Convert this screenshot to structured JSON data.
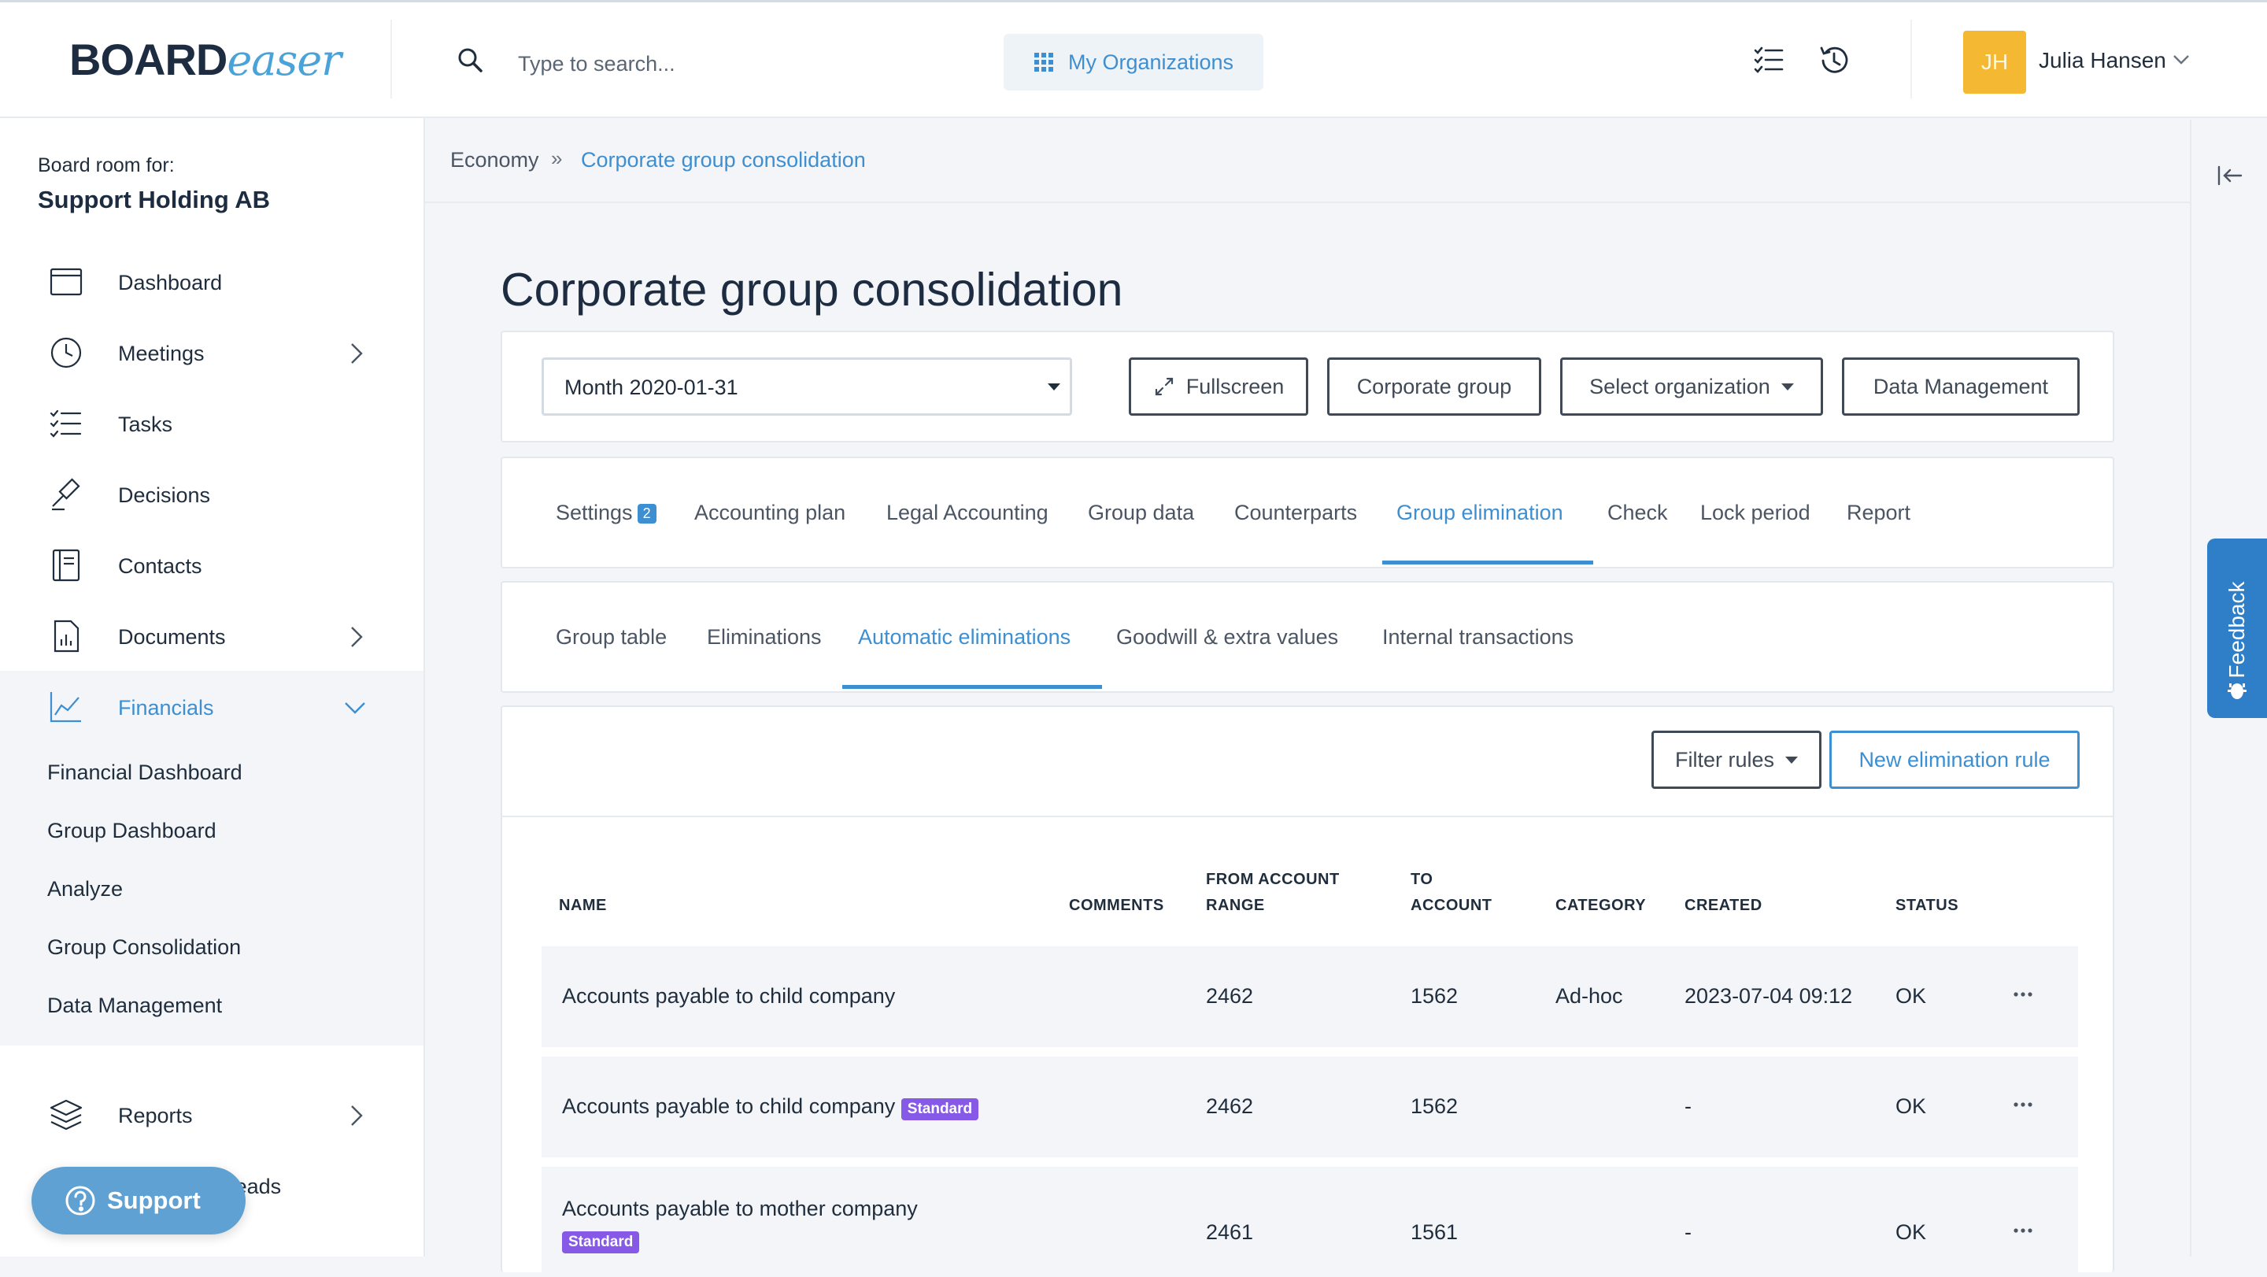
{
  "topbar": {
    "logo_bold": "BOARD",
    "logo_script": "easer",
    "search_placeholder": "Type to search...",
    "my_orgs_label": "My Organizations",
    "user_initials": "JH",
    "user_name": "Julia Hansen"
  },
  "sidebar": {
    "room_label": "Board room for:",
    "room_name": "Support Holding AB",
    "items": [
      {
        "label": "Dashboard",
        "icon": "calendar-icon"
      },
      {
        "label": "Meetings",
        "icon": "clock-icon"
      },
      {
        "label": "Tasks",
        "icon": "checklist-icon"
      },
      {
        "label": "Decisions",
        "icon": "gavel-icon"
      },
      {
        "label": "Contacts",
        "icon": "address-book-icon"
      },
      {
        "label": "Documents",
        "icon": "document-chart-icon"
      },
      {
        "label": "Financials",
        "icon": "line-chart-icon"
      },
      {
        "label": "Reports",
        "icon": "layers-icon"
      },
      {
        "label": "Message threads",
        "icon": "chat-icon"
      }
    ],
    "financials_sub": [
      "Financial Dashboard",
      "Group Dashboard",
      "Analyze",
      "Group Consolidation",
      "Data Management"
    ],
    "support_label": "Support"
  },
  "breadcrumb": {
    "parent": "Economy",
    "current": "Corporate group consolidation"
  },
  "feedback_label": "Feedback",
  "main": {
    "title": "Corporate group consolidation",
    "period_select": "Month 2020-01-31",
    "buttons": {
      "fullscreen": "Fullscreen",
      "corporate_group": "Corporate group",
      "select_org": "Select organization",
      "data_management": "Data Management"
    },
    "tabs": [
      "Settings",
      "Accounting plan",
      "Legal Accounting",
      "Group data",
      "Counterparts",
      "Group elimination",
      "Check",
      "Lock period",
      "Report"
    ],
    "settings_badge": "2",
    "active_tab": "Group elimination",
    "subtabs": [
      "Group table",
      "Eliminations",
      "Automatic eliminations",
      "Goodwill & extra values",
      "Internal transactions"
    ],
    "active_subtab": "Automatic eliminations",
    "filter_label": "Filter rules",
    "new_rule_label": "New elimination rule",
    "columns": {
      "name": "NAME",
      "comments": "COMMENTS",
      "from_1": "FROM ACCOUNT",
      "from_2": "RANGE",
      "to_1": "TO",
      "to_2": "ACCOUNT",
      "category": "CATEGORY",
      "created": "CREATED",
      "status": "STATUS"
    },
    "rows": [
      {
        "name": "Accounts payable to child company",
        "tag": "",
        "from": "2462",
        "to": "1562",
        "category": "Ad-hoc",
        "created": "2023-07-04 09:12",
        "status": "OK"
      },
      {
        "name": "Accounts payable to child company",
        "tag": "Standard",
        "from": "2462",
        "to": "1562",
        "category": "",
        "created": "-",
        "status": "OK"
      },
      {
        "name": "Accounts payable to mother company",
        "tag": "Standard",
        "from": "2461",
        "to": "1561",
        "category": "",
        "created": "-",
        "status": "OK"
      }
    ]
  },
  "colors": {
    "accent": "#3d8fd1",
    "avatar": "#f4b833",
    "standard_tag": "#8659e6",
    "feedback": "#2e7fc8"
  }
}
